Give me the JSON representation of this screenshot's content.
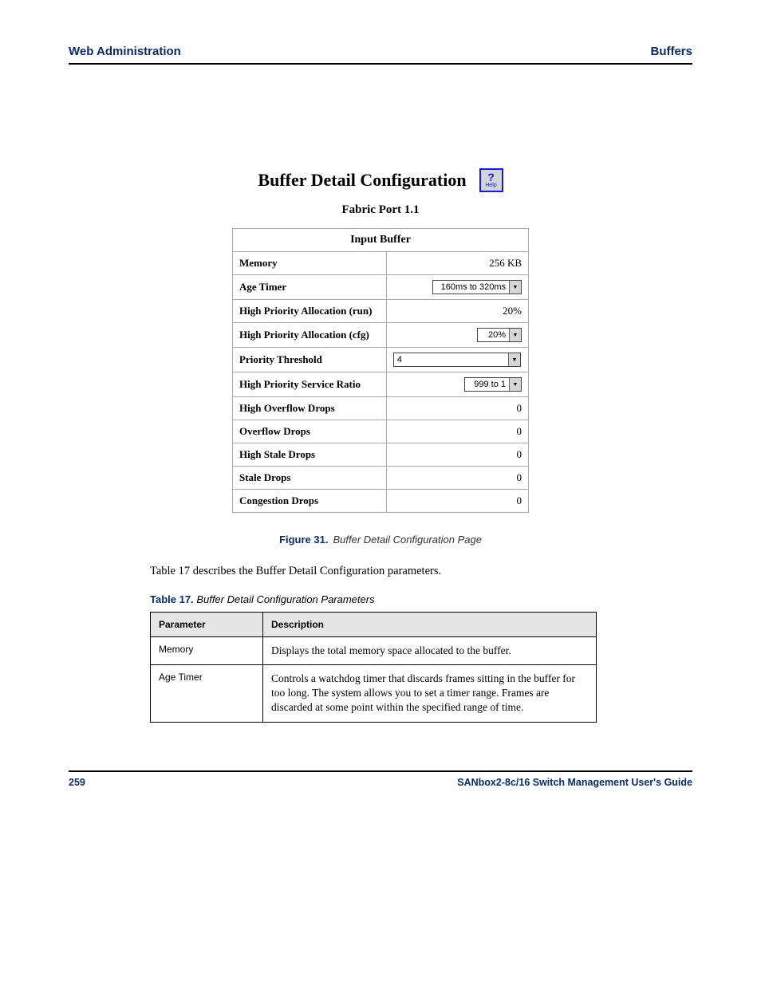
{
  "header": {
    "left": "Web Administration",
    "right": "Buffers"
  },
  "figure": {
    "title": "Buffer Detail Configuration",
    "help_label": "Help",
    "subtitle": "Fabric Port 1.1",
    "table_header": "Input Buffer",
    "rows": {
      "memory": {
        "label": "Memory",
        "value": "256 KB"
      },
      "age_timer": {
        "label": "Age Timer",
        "value": "160ms to 320ms"
      },
      "hpa_run": {
        "label": "High Priority Allocation (run)",
        "value": "20%"
      },
      "hpa_cfg": {
        "label": "High Priority Allocation (cfg)",
        "value": "20%"
      },
      "priority_threshold": {
        "label": "Priority Threshold",
        "value": "4"
      },
      "hpsr": {
        "label": "High Priority Service Ratio",
        "value": "999 to 1"
      },
      "high_overflow": {
        "label": "High Overflow Drops",
        "value": "0"
      },
      "overflow": {
        "label": "Overflow Drops",
        "value": "0"
      },
      "high_stale": {
        "label": "High Stale Drops",
        "value": "0"
      },
      "stale": {
        "label": "Stale Drops",
        "value": "0"
      },
      "congestion": {
        "label": "Congestion Drops",
        "value": "0"
      }
    },
    "caption_num": "Figure 31.",
    "caption_text": "Buffer Detail Configuration Page"
  },
  "body_text": "Table 17 describes the Buffer Detail Configuration parameters.",
  "desc": {
    "caption_num": "Table 17.",
    "caption_text": "Buffer Detail Configuration Parameters",
    "col1": "Parameter",
    "col2": "Description",
    "rows": [
      {
        "field": "Memory",
        "desc": "Displays the total memory space allocated to the buffer."
      },
      {
        "field": "Age Timer",
        "desc": "Controls a watchdog timer that discards frames sitting in the buffer for too long. The system allows you to set a timer range. Frames are discarded at some point within the specified range of time."
      }
    ]
  },
  "footer": {
    "left": "259",
    "right": "SANbox2-8c/16 Switch Management User's Guide"
  }
}
